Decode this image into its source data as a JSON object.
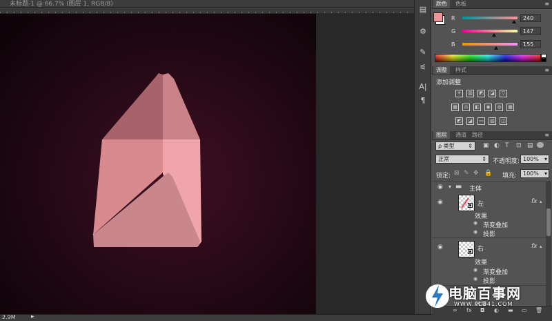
{
  "document": {
    "tab_title": "未标题-1 @ 66.7% (图层 1, RGB/8)",
    "status_size": "2.9M",
    "status_arrow": "▸"
  },
  "dock": {
    "icons": [
      "history-icon",
      "properties-icon",
      "brush-icon",
      "brush-presets-icon",
      "character-icon",
      "paragraph-icon"
    ],
    "glyphs": [
      "▤",
      "⚙",
      "✎",
      "⚟",
      "A|",
      "¶"
    ]
  },
  "color_panel": {
    "tabs": [
      "颜色",
      "色板"
    ],
    "foreground": "#f09399",
    "background": "#ffffff",
    "channels": [
      {
        "label": "R",
        "value": "240",
        "fraction": 0.94
      },
      {
        "label": "G",
        "value": "147",
        "fraction": 0.58
      },
      {
        "label": "B",
        "value": "155",
        "fraction": 0.61
      }
    ]
  },
  "adjustments_panel": {
    "tabs": [
      "调整",
      "样式"
    ],
    "title": "添加调整",
    "row1": [
      "☀",
      "▥",
      "◩",
      "◪",
      "▽"
    ],
    "row2": [
      "▦",
      "⚖",
      "◧",
      "◉",
      "◍",
      "▦"
    ],
    "row3": [
      "◩",
      "◪",
      "▭",
      "▨",
      "◫"
    ]
  },
  "layers_panel": {
    "tabs": [
      "图层",
      "通道",
      "路径"
    ],
    "filter_kind": "ρ 类型",
    "blend_mode": "正常",
    "opacity_label": "不透明度:",
    "opacity_value": "100%",
    "lock_label": "锁定:",
    "fill_label": "填充:",
    "fill_value": "100%",
    "group_name": "主体",
    "layers": [
      {
        "name": "左",
        "effects_label": "效果",
        "effects": [
          "渐变叠加",
          "投影"
        ]
      },
      {
        "name": "右",
        "effects_label": "效果",
        "effects": [
          "渐变叠加",
          "投影"
        ]
      }
    ],
    "partial_effects_label": "效果",
    "fx_label": "fx",
    "footer_icons": [
      "∞",
      "fx",
      "◘",
      "◐",
      "▬",
      "▭",
      "🗑"
    ]
  },
  "watermark": {
    "title": "电脑百事网",
    "url": "WWW.PC841.COM"
  }
}
